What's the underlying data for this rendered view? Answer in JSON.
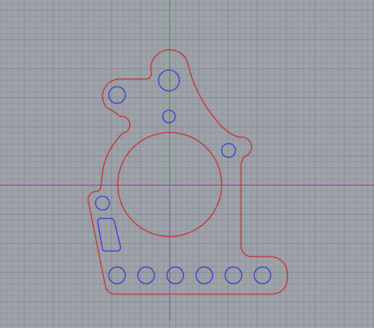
{
  "viewport": {
    "view": "top",
    "background_color": "#9ea2a9"
  },
  "axes": {
    "x_axis_color": "#8a4a8e",
    "y_axis_color": "#3a9a3a",
    "y_axis_lower_color": "#7c5aa0"
  },
  "colors": {
    "curve_red": "#cc2222",
    "curve_blue": "#2a2ad8"
  },
  "part": {
    "outer_profile_color": "red",
    "center_bore_color": "red",
    "hole_color": "blue",
    "bottom_hole_count": 6,
    "slot_count": 1
  }
}
